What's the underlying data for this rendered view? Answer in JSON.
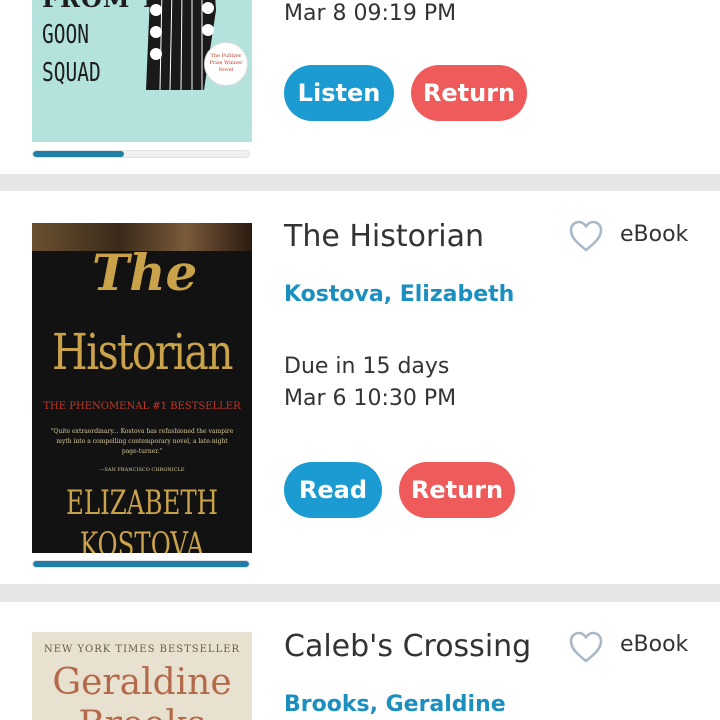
{
  "items": [
    {
      "cover_lines": [
        "FROM THE",
        "GOON",
        "SQUAD"
      ],
      "badge_text": "The Pulitzer Prize Winner Novel",
      "due_date": "Mar 8 09:19 PM",
      "primary_action": "Listen",
      "return_action": "Return",
      "progress": 0.42
    },
    {
      "title": "The Historian",
      "author": "Kostova, Elizabeth",
      "format": "eBook",
      "due_in": "Due in 15 days",
      "due_date": "Mar 6 10:30 PM",
      "primary_action": "Read",
      "return_action": "Return",
      "progress": 1.0,
      "cover": {
        "title_top": "The",
        "title_main": "Historian",
        "tagline": "THE PHENOMENAL #1 BESTSELLER",
        "quote": "\"Quite extraordinary... Kostova has refashioned the vampire myth into a compelling contemporary novel, a late-night page-turner.\"",
        "quote_source": "—SAN FRANCISCO CHRONICLE",
        "author_first": "ELIZABETH",
        "author_last": "KOSTOVA"
      }
    },
    {
      "title": "Caleb's Crossing",
      "author": "Brooks, Geraldine",
      "format": "eBook",
      "cover": {
        "tagline": "NEW YORK TIMES BESTSELLER",
        "author_first": "Geraldine",
        "author_last": "Brooks"
      }
    }
  ],
  "colors": {
    "accent_blue": "#1b9bd1",
    "return_red": "#ef5b5b",
    "author_blue": "#1b8fbf",
    "progress_fill": "#1f7fa8"
  },
  "icons": {
    "favorite": "heart-outline-icon"
  }
}
